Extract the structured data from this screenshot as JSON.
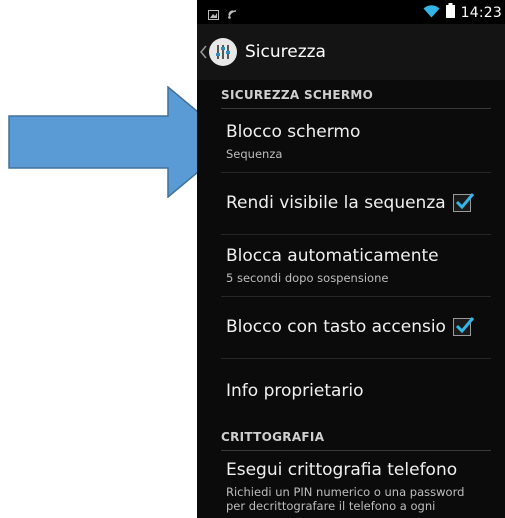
{
  "status_bar": {
    "time": "14:23",
    "icons": [
      "image-notification-icon",
      "cast-notification-icon",
      "wifi-icon",
      "battery-icon"
    ]
  },
  "action_bar": {
    "title": "Sicurezza",
    "icon": "settings-sliders-icon"
  },
  "sections": [
    {
      "header": "SICUREZZA SCHERMO"
    },
    {
      "header": "CRITTOGRAFIA"
    }
  ],
  "prefs": [
    {
      "title": "Blocco schermo",
      "summary": "Sequenza"
    },
    {
      "title": "Rendi visibile la sequenza",
      "checked": true
    },
    {
      "title": "Blocca automaticamente",
      "summary": "5 secondi dopo sospensione"
    },
    {
      "title": "Blocco con tasto accensio",
      "checked": true
    },
    {
      "title": "Info proprietario"
    },
    {
      "title": "Esegui crittografia telefono",
      "summary_line1": "Richiedi un PIN numerico o una password",
      "summary_line2": "per decrittografare il telefono a ogni"
    }
  ],
  "colors": {
    "accent_check": "#33b5e5",
    "arrow_fill": "#5b9bd5",
    "arrow_stroke": "#41719c",
    "background": "#0b0b0b"
  }
}
